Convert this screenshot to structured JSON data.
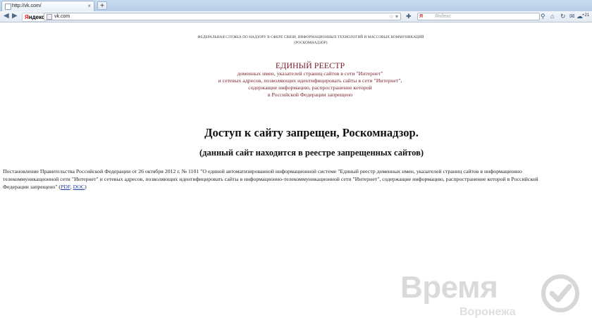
{
  "browser": {
    "tab_title": "http://vk.com/",
    "new_tab_label": "+",
    "yandex_badge": {
      "first": "Я",
      "rest": "ндекс"
    },
    "url": "vk.com",
    "search": {
      "engine": "Я",
      "placeholder": "Яндекс"
    },
    "extension_count": "+21",
    "icons": [
      "back-icon",
      "forward-icon",
      "bookmark-star-icon",
      "search-icon",
      "home-icon",
      "refresh-icon",
      "mail-icon",
      "weather-icon"
    ]
  },
  "page": {
    "agency": "ФЕДЕРАЛЬНАЯ СЛУЖБА ПО НАДЗОРУ В СФЕРЕ СВЯЗИ, ИНФОРМАЦИОННЫХ ТЕХНОЛОГИЙ И МАССОВЫХ КОММУНИКАЦИЙ",
    "agency_abbr": "(РОСКОМНАДЗОР)",
    "registry_head": "ЕДИНЫЙ РЕЕСТР",
    "registry_lines": [
      "доменных имен, указателей страниц сайтов в сети \"Интернет\"",
      "и сетевых адресов, позволяющих идентифицировать сайты в сети \"Интернет\",",
      "содержащие информацию, распространение которой",
      "в Российской Федерации запрещено"
    ],
    "headline": "Доступ к сайту запрещен, Роскомнадзор.",
    "subline": "(данный сайт находится в реестре запрещенных сайтов)",
    "decree": {
      "line1": "Постановление Правительства Российской Федерации от 26 октября 2012 г. № 1101 \"О единой автоматизированной информационной системе \"Единый реестр доменных имен, указателей страниц сайтов в информационно",
      "line2": "телекоммуникационной сети \"Интернет\" и сетевых адресов, позволяющих идентифицировать сайты в информационно-телекоммуникационной сети \"Интернет\", содержащие информацию, распространение которой в Российской",
      "line3": "Федерации запрещено\"",
      "open_paren": " (",
      "pdf": "PDF",
      "sep": ", ",
      "doc": "DOC",
      "close_paren": ")"
    }
  },
  "watermark": {
    "word": "Время",
    "sub": "Воронежа",
    "colors": {
      "mark": "#cfcfcf"
    }
  }
}
